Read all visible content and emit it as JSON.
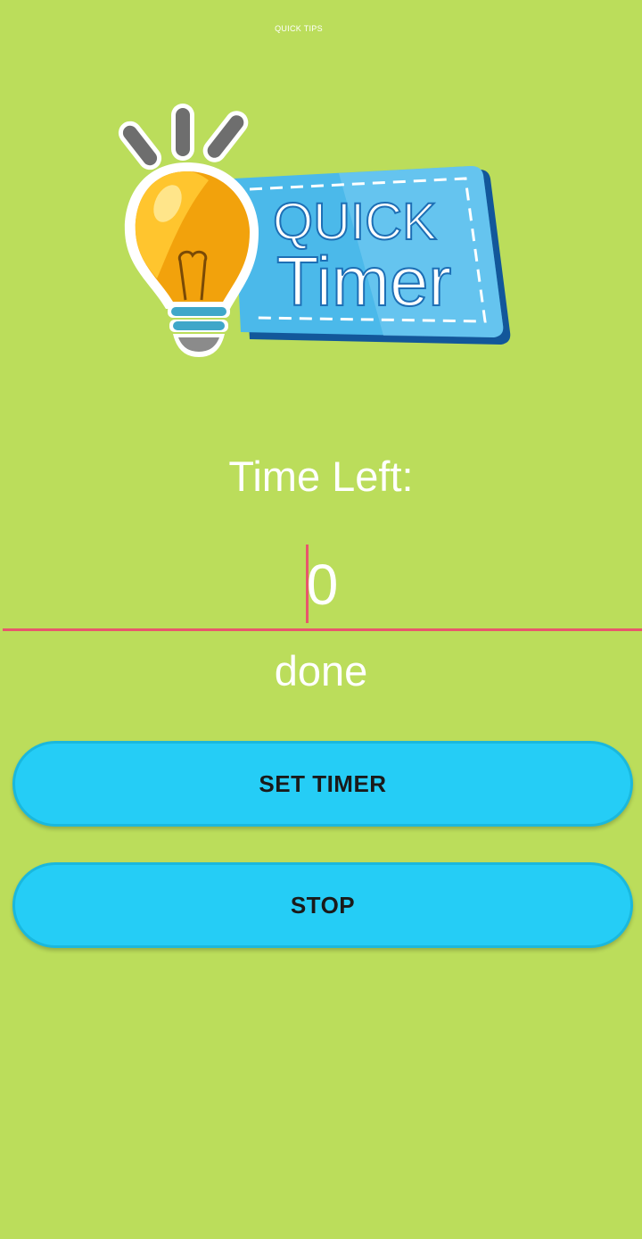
{
  "header": {
    "title": "QUICK TIPS"
  },
  "logo": {
    "line1": "QUICK",
    "line2": "Timer",
    "icon": "lightbulb-icon"
  },
  "timer": {
    "label": "Time Left:",
    "value": "0",
    "status": "done"
  },
  "buttons": {
    "set_timer": "SET TIMER",
    "stop": "STOP"
  },
  "colors": {
    "background": "#bbdd5b",
    "button": "#25cdf6",
    "underline": "#e8566c",
    "text": "#ffffff"
  }
}
